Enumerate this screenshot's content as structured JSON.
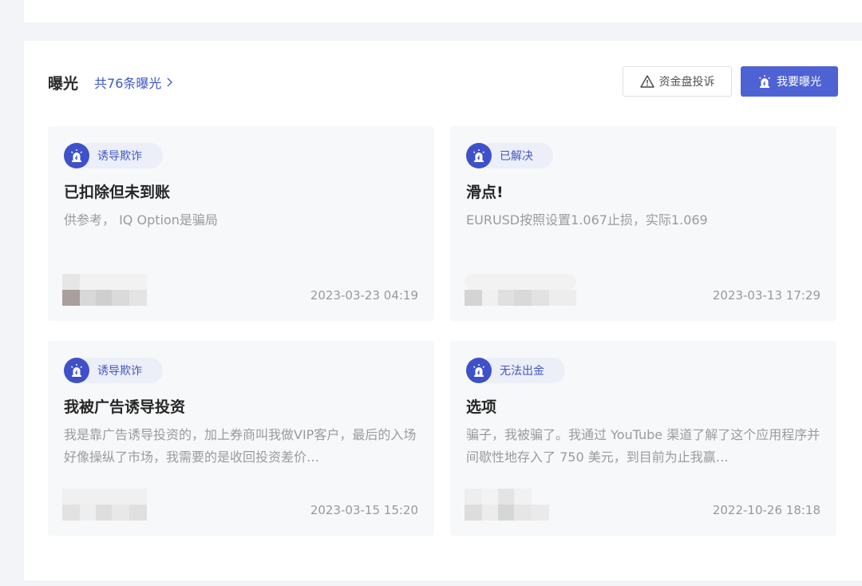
{
  "panel": {
    "title": "曝光",
    "count_link": "共76条曝光",
    "complaint_button": "资金盘投诉",
    "expose_button": "我要曝光"
  },
  "cards": [
    {
      "tag": "诱导欺诈",
      "title": "已扣除但未到账",
      "desc": "供参考， IQ Option是骗局",
      "date": "2023-03-23 04:19"
    },
    {
      "tag": "已解决",
      "title": "滑点!",
      "desc": "EURUSD按照设置1.067止损，实际1.069",
      "date": "2023-03-13 17:29"
    },
    {
      "tag": "诱导欺诈",
      "title": "我被广告诱导投资",
      "desc": "我是靠广告诱导投资的，加上券商叫我做VIP客户，最后的入场好像操纵了市场，我需要的是收回投资差价…",
      "date": "2023-03-15 15:20"
    },
    {
      "tag": "无法出金",
      "title": "选项",
      "desc": "骗子，我被骗了。我通过 YouTube 渠道了解了这个应用程序并间歇性地存入了 750 美元，到目前为止我赢…",
      "date": "2022-10-26 18:18"
    }
  ],
  "colors": {
    "accent": "#4f62d3",
    "tag_text": "#4258c6",
    "tag_icon_bg": "#3f51c9"
  },
  "icons": {
    "complaint": "warning-triangle-icon",
    "expose": "alarm-siren-icon",
    "tag": "alarm-siren-icon",
    "count_link": "chevron-right-icon"
  }
}
